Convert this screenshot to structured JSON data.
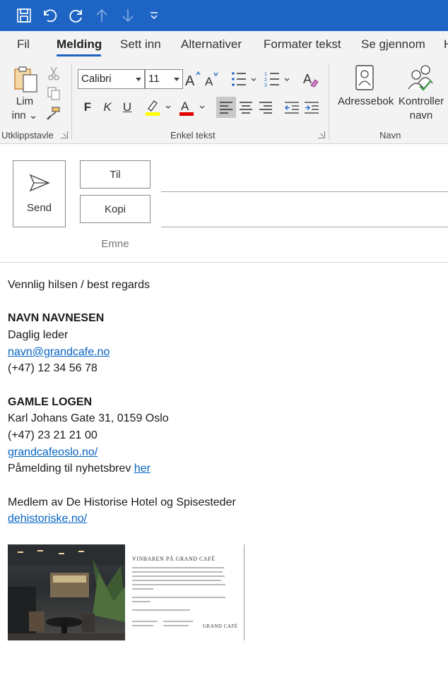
{
  "ribbon_tabs": [
    {
      "label": "Fil"
    },
    {
      "label": "Melding"
    },
    {
      "label": "Sett inn"
    },
    {
      "label": "Alternativer"
    },
    {
      "label": "Formater tekst"
    },
    {
      "label": "Se gjennom"
    },
    {
      "label": "H"
    }
  ],
  "clipboard": {
    "paste_label_line1": "Lim",
    "paste_label_line2": "inn",
    "group_label": "Utklippstavle"
  },
  "font": {
    "family": "Calibri",
    "size": "11",
    "bold_label": "F",
    "italic_label": "K",
    "underline_label": "U",
    "group_label": "Enkel tekst",
    "highlight_color": "#ffff00",
    "font_color": "#e00000"
  },
  "names": {
    "address_book_label": "Adressebok",
    "check_names_line1": "Kontroller",
    "check_names_line2": "navn",
    "group_label": "Navn"
  },
  "compose": {
    "send_label": "Send",
    "to_label": "Til",
    "cc_label": "Kopi",
    "subject_label": "Emne"
  },
  "signature": {
    "greeting": "Vennlig hilsen / best regards",
    "name": "NAVN NAVNESEN",
    "title": "Daglig leder",
    "email": "navn@grandcafe.no",
    "phone": "(+47) 12 34 56 78",
    "company": "GAMLE LOGEN",
    "address": "Karl Johans Gate 31, 0159 Oslo",
    "company_phone": "(+47) 23 21 21 00",
    "website": "grandcafeoslo.no/",
    "newsletter_text": "Påmelding til nyhetsbrev ",
    "newsletter_link": "her",
    "member_text": "Medlem av De Historise Hotel og Spisesteder",
    "member_link": "dehistoriske.no/"
  },
  "banner": {
    "title": "VINBAREN PÅ GRAND CAFÉ",
    "brand": "GRAND CAFÉ"
  },
  "colors": {
    "title_bar": "#1d64c4",
    "link": "#0563c1",
    "accent": "#1d64c4"
  }
}
